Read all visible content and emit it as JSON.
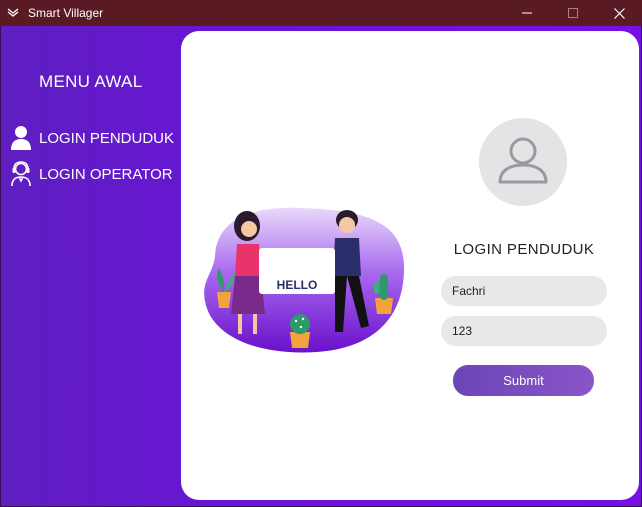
{
  "window": {
    "title": "Smart Villager",
    "controls": [
      "minimize-icon",
      "maximize-icon",
      "close-icon"
    ]
  },
  "sidebar": {
    "title": "MENU AWAL",
    "items": [
      {
        "label": "LOGIN PENDUDUK",
        "icon": "user-icon"
      },
      {
        "label": "LOGIN OPERATOR",
        "icon": "operator-icon"
      }
    ]
  },
  "illustration": {
    "sign_text": "HELLO"
  },
  "form": {
    "avatar_icon": "avatar-placeholder-icon",
    "title": "LOGIN PENDUDUK",
    "username_value": "Fachri",
    "password_value": "123",
    "submit_label": "Submit"
  },
  "colors": {
    "titlebar": "#5a1a24",
    "sidebar_gradient_start": "#5e1ec0",
    "sidebar_gradient_end": "#7610e6",
    "submit_button": "#7a4fc0",
    "input_background": "#e8e8ea"
  }
}
